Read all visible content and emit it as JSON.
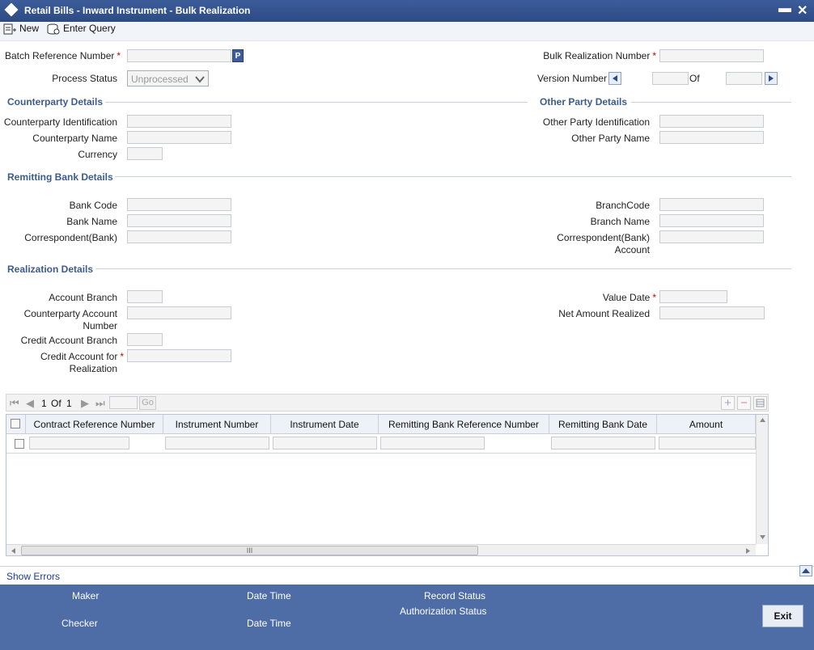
{
  "window": {
    "title": "Retail Bills - Inward Instrument - Bulk Realization",
    "minimize": "▬",
    "close": "✕"
  },
  "toolbar": {
    "new_label": "New",
    "enter_query_label": "Enter Query"
  },
  "header": {
    "batch_ref_label": "Batch Reference Number",
    "lov_button": "P",
    "process_status_label": "Process Status",
    "process_status_value": "Unprocessed",
    "bulk_realization_label": "Bulk Realization Number",
    "version_number_label": "Version Number",
    "of_label": "Of"
  },
  "counterparty": {
    "title": "Counterparty Details",
    "identification_label": "Counterparty Identification",
    "name_label": "Counterparty Name",
    "currency_label": "Currency"
  },
  "other_party": {
    "title": "Other Party Details",
    "identification_label": "Other Party Identification",
    "name_label": "Other Party Name"
  },
  "remitting_bank": {
    "title": "Remitting Bank Details",
    "bank_code_label": "Bank Code",
    "bank_name_label": "Bank Name",
    "correspondent_label": "Correspondent(Bank)",
    "branch_code_label": "BranchCode",
    "branch_name_label": "Branch Name",
    "correspondent_account_label_1": "Correspondent(Bank)",
    "correspondent_account_label_2": "Account"
  },
  "realization": {
    "title": "Realization Details",
    "account_branch_label": "Account Branch",
    "cp_account_label_1": "Counterparty Account",
    "cp_account_label_2": "Number",
    "credit_branch_label": "Credit Account Branch",
    "credit_account_label_1": "Credit Account for",
    "credit_account_label_2": "Realization",
    "value_date_label": "Value Date",
    "net_amount_label": "Net Amount Realized"
  },
  "grid": {
    "page_current": "1",
    "page_of": "Of",
    "page_total": "1",
    "go_label": "Go",
    "columns": [
      "Contract Reference Number",
      "Instrument Number",
      "Instrument Date",
      "Remitting Bank Reference Number",
      "Remitting Bank Date",
      "Amount"
    ],
    "scroll_grip": "III"
  },
  "show_errors": "Show Errors",
  "footer": {
    "maker_label": "Maker",
    "checker_label": "Checker",
    "date_time_label_1": "Date Time",
    "date_time_label_2": "Date Time",
    "record_status_label": "Record Status",
    "authorization_status_label": "Authorization Status",
    "exit_label": "Exit"
  },
  "colors": {
    "title_bar": "#2d4a84",
    "footer": "#4e6da6",
    "section_title": "#3b5c8f",
    "required": "#cc0000"
  }
}
